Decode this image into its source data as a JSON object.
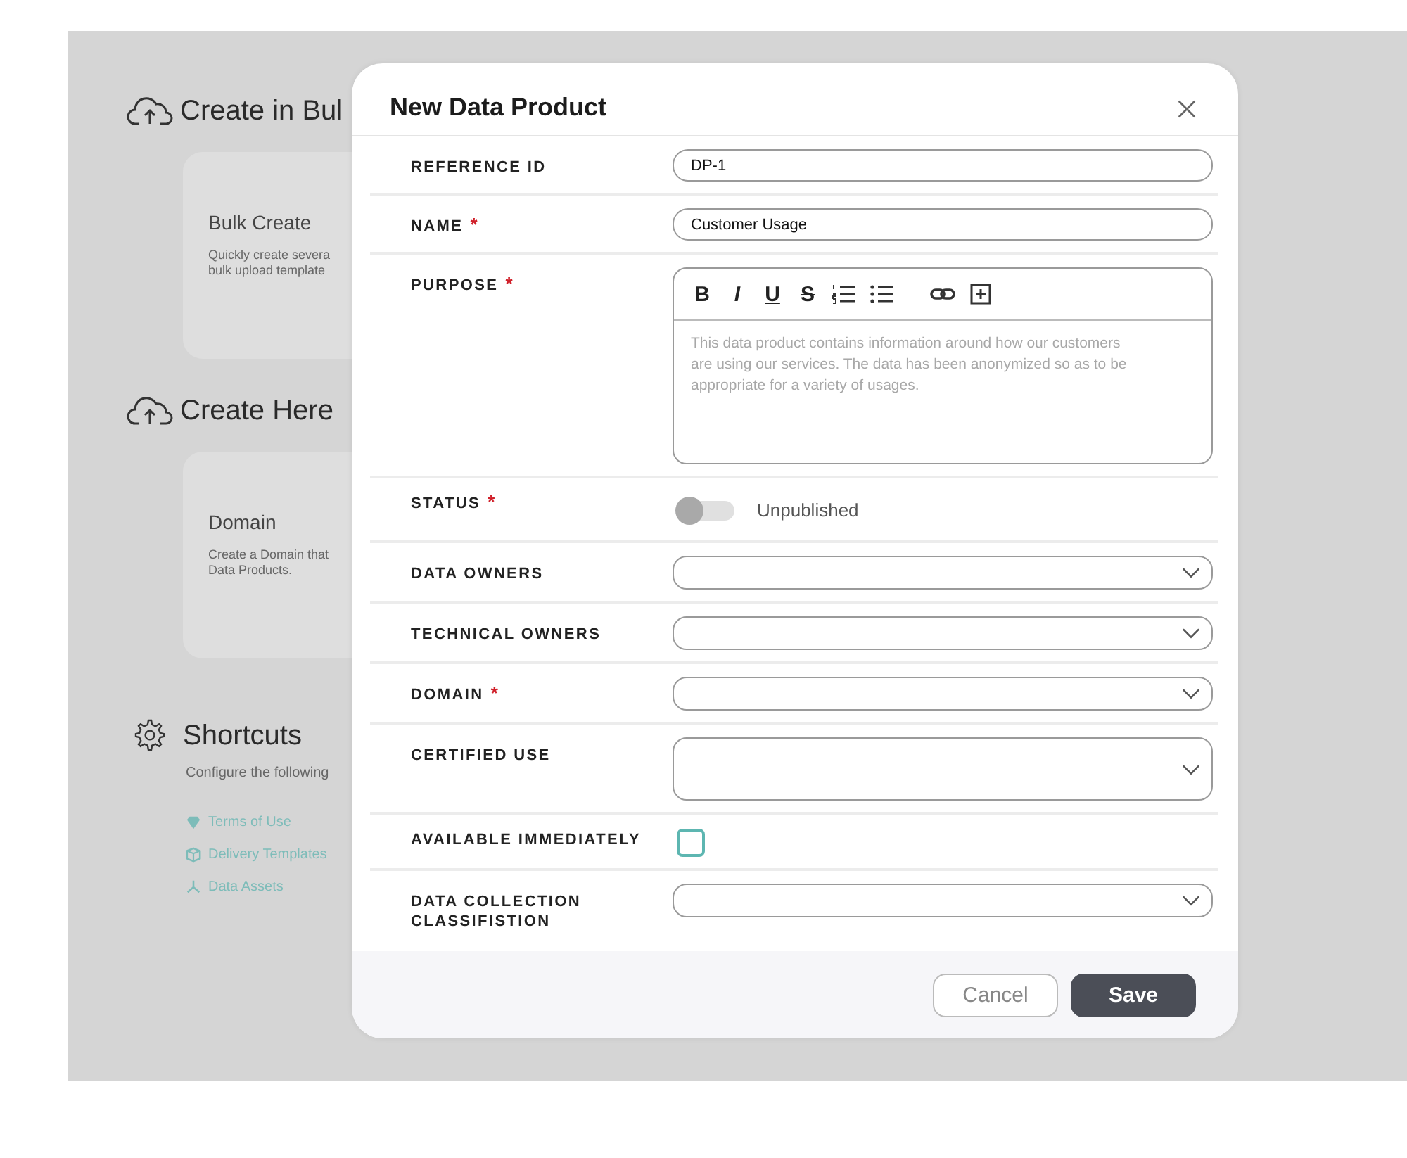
{
  "background": {
    "sections": [
      {
        "title": "Create in Bul",
        "card": {
          "title": "Bulk Create",
          "lines": [
            "Quickly create severa",
            "bulk upload template"
          ]
        }
      },
      {
        "title": "Create Here",
        "card": {
          "title": "Domain",
          "lines": [
            "Create a Domain that",
            "Data Products."
          ]
        }
      }
    ],
    "shortcuts": {
      "title": "Shortcuts",
      "description": "Configure the following",
      "links": [
        {
          "kind": "terms",
          "label": "Terms of Use"
        },
        {
          "kind": "delivery",
          "label": "Delivery Templates"
        },
        {
          "kind": "assets",
          "label": "Data Assets"
        }
      ]
    }
  },
  "dialog": {
    "title": "New Data Product",
    "fields": [
      {
        "kind": "text",
        "label": "REFERENCE ID",
        "required": false,
        "value": "DP-1"
      },
      {
        "kind": "text",
        "label": "NAME",
        "required": true,
        "value": "Customer Usage"
      },
      {
        "kind": "richtext",
        "label": "PURPOSE",
        "required": true,
        "toolbar": [
          {
            "kind": "bold",
            "label": "B"
          },
          {
            "kind": "italic",
            "label": "I"
          },
          {
            "kind": "underline",
            "label": "U"
          },
          {
            "kind": "strike",
            "label": "S"
          }
        ],
        "placeholder": "This data product contains information around how our customers are using our services. The data has been anonymized so as to be appropriate for a variety of usages."
      },
      {
        "kind": "toggle",
        "label": "STATUS",
        "required": true,
        "on": false,
        "state_label": "Unpublished"
      },
      {
        "kind": "select",
        "label": "DATA OWNERS",
        "required": false
      },
      {
        "kind": "select",
        "label": "TECHNICAL OWNERS",
        "required": false
      },
      {
        "kind": "select",
        "label": "DOMAIN",
        "required": true
      },
      {
        "kind": "multiselect",
        "label": "CERTIFIED USE",
        "required": false
      },
      {
        "kind": "checkbox",
        "label": "AVAILABLE IMMEDIATELY",
        "required": false,
        "checked": false
      },
      {
        "kind": "select",
        "label": "DATA COLLECTION CLASSIFISTION",
        "required": false
      }
    ],
    "required_mark": "*",
    "buttons": [
      {
        "kind": "secondary",
        "label": "Cancel"
      },
      {
        "kind": "primary",
        "label": "Save"
      }
    ]
  }
}
